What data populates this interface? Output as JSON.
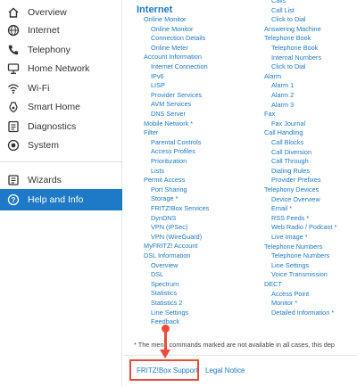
{
  "sidebar": {
    "items": [
      {
        "label": "Overview",
        "icon": "home-icon"
      },
      {
        "label": "Internet",
        "icon": "globe-icon"
      },
      {
        "label": "Telephony",
        "icon": "phone-icon"
      },
      {
        "label": "Home Network",
        "icon": "network-icon"
      },
      {
        "label": "Wi-Fi",
        "icon": "wifi-icon"
      },
      {
        "label": "Smart Home",
        "icon": "smart-home-icon"
      },
      {
        "label": "Diagnostics",
        "icon": "diagnostics-icon"
      },
      {
        "label": "System",
        "icon": "system-icon"
      }
    ],
    "wizards": {
      "label": "Wizards",
      "icon": "wizard-icon"
    },
    "help": {
      "label": "Help and Info",
      "icon": "question-icon"
    }
  },
  "main": {
    "section_title": "Internet",
    "left_links": [
      "Online Monitor",
      "Online Monitor",
      "Connection Details",
      "Online Meter",
      "Account Information",
      "Internet Connection",
      "IPv6",
      "LISP",
      "Provider Services",
      "AVM Services",
      "DNS Server",
      "Mobile Network *",
      "Filter",
      "Parental Controls",
      "Access Profiles",
      "Prioritization",
      "Lists",
      "Permit Access",
      "Port Sharing",
      "Storage *",
      "FRITZ!Box Services",
      "DynDNS",
      "VPN (IPSec)",
      "VPN (WireGuard)",
      "MyFRITZ! Account",
      "DSL Information",
      "Overview",
      "DSL",
      "Spectrum",
      "Statistics",
      "Statistics 2",
      "Line Settings",
      "Feedback"
    ],
    "right_links": [
      "Calls",
      "Call List",
      "Click to Dial",
      "Answering Machine",
      "Telephone Book",
      "Telephone Book",
      "Internal Numbers",
      "Click to Dial",
      "Alarm",
      "Alarm 1",
      "Alarm 2",
      "Alarm 3",
      "Fax",
      "Fax Journal",
      "Call Handling",
      "Call Blocks",
      "Call Diversion",
      "Call Through",
      "Dialing Rules",
      "Provider Prefixes",
      "Telephony Devices",
      "Device Overview",
      "Email *",
      "RSS Feeds *",
      "Web Radio / Podcast *",
      "Live Image *",
      "Telephone Numbers",
      "Telephone Numbers",
      "Line Settings",
      "Voice Transmission",
      "DECT",
      "Access Point",
      "Monitor *",
      "Detailed Information *"
    ],
    "footnote": "*   The menu commands marked are not available in all cases, this dep",
    "footer": {
      "support": "FRITZ!Box Support",
      "legal": "Legal Notice"
    }
  },
  "colors": {
    "accent": "#1e79c6",
    "highlight": "#e94c3c"
  }
}
